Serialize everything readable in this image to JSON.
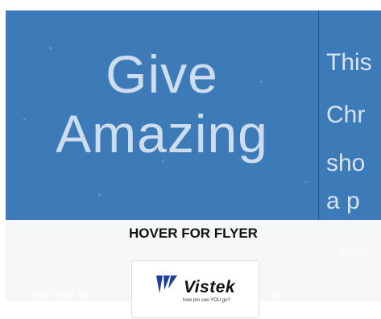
{
  "banner": {
    "headline_line1": "Give",
    "headline_line2": "Amazing",
    "right_lines": [
      "This",
      "Chr",
      "sho",
      "a p"
    ]
  },
  "hover_label": "HOVER FOR FLYER",
  "faint_text": {
    "left": "Knock their soc",
    "mid": "tek",
    "right": "Save tir"
  },
  "logo": {
    "name": "Vistek",
    "tagline": "how pro can YOU go?",
    "accent_color": "#1f3f9c"
  },
  "colors": {
    "banner_bg": "#3d7ab8",
    "card_bg": "#f5f7f9"
  }
}
